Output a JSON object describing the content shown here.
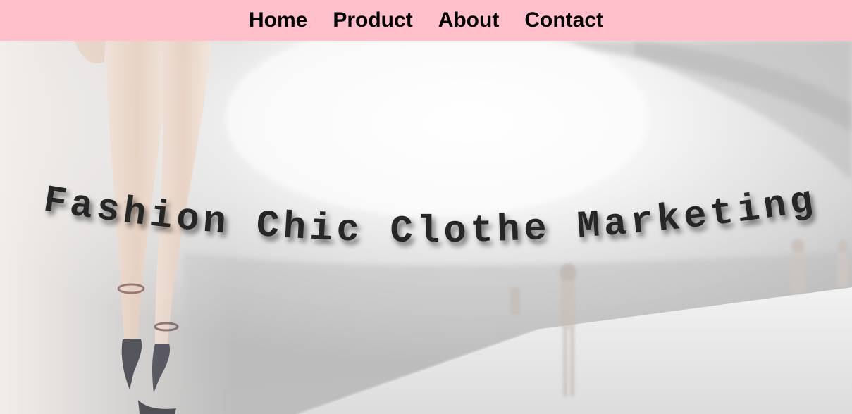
{
  "nav": {
    "items": [
      {
        "label": "Home"
      },
      {
        "label": "Product"
      },
      {
        "label": "About"
      },
      {
        "label": "Contact"
      }
    ],
    "background_color": "#ffc0cb"
  },
  "hero": {
    "title": "Fashion Chic Clothe Marketing",
    "image_description_icon": "runway-photo"
  }
}
